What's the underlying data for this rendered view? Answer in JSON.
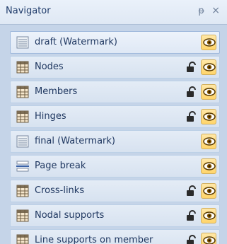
{
  "header": {
    "title": "Navigator",
    "pin_glyph": "ᵽ",
    "close_glyph": "×"
  },
  "items": [
    {
      "label": "draft (Watermark)",
      "icon": "watermark-icon",
      "locked": false,
      "visible": true
    },
    {
      "label": "Nodes",
      "icon": "table-icon",
      "locked": true,
      "visible": true
    },
    {
      "label": "Members",
      "icon": "table-icon",
      "locked": true,
      "visible": true
    },
    {
      "label": "Hinges",
      "icon": "table-icon",
      "locked": true,
      "visible": true
    },
    {
      "label": "final (Watermark)",
      "icon": "watermark-icon",
      "locked": false,
      "visible": true
    },
    {
      "label": "Page break",
      "icon": "page-break-icon",
      "locked": false,
      "visible": true
    },
    {
      "label": "Cross-links",
      "icon": "table-icon",
      "locked": true,
      "visible": true
    },
    {
      "label": "Nodal supports",
      "icon": "table-icon",
      "locked": true,
      "visible": true
    },
    {
      "label": "Line supports on member",
      "icon": "table-icon",
      "locked": true,
      "visible": true
    }
  ],
  "colors": {
    "panel_bg": "#c5d4e8",
    "title_text": "#1f3b6a",
    "item_text": "#203861",
    "eye_bg": "#ffd56a"
  }
}
